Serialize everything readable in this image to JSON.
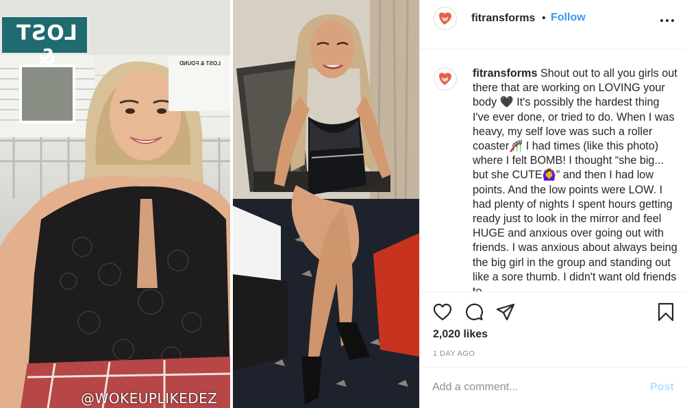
{
  "post": {
    "image": {
      "left_sign_text": "LOST &",
      "notice_title": "LOST & FOUND",
      "watermark": "@WOKEUPLIKEDEZ"
    },
    "header": {
      "username": "fitransforms",
      "separator": "•",
      "follow_label": "Follow",
      "more_icon": "more-horizontal-icon"
    },
    "caption": {
      "username": "fitransforms",
      "text": "Shout out to all you girls out there that are working on LOVING your body 🖤 It's possibly the hardest thing I've ever done, or tried to do. When I was heavy, my self love was such a roller coaster🎢 I had times (like this photo) where I felt BOMB! I thought “she big... but she CUTE🙆‍♀️” and then I had low points. And the low points were LOW. I had plenty of nights I spent hours getting ready just to look in the mirror and feel HUGE and anxious over going out with friends. I was anxious about always being the big girl in the group and standing out like a sore thumb. I didn't want old friends to"
    },
    "actions": {
      "icons": [
        "heart-icon",
        "comment-icon",
        "share-icon",
        "bookmark-icon"
      ],
      "likes": "2,020 likes",
      "time_ago": "1 DAY AGO"
    },
    "comment_box": {
      "placeholder": "Add a comment...",
      "post_label": "Post"
    }
  },
  "colors": {
    "link_blue": "#3897f0",
    "post_disabled": "#b9dcfb",
    "muted": "#8e8e8e",
    "text": "#262626",
    "avatar_accent": "#e8604a"
  }
}
